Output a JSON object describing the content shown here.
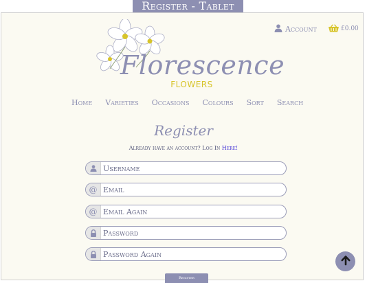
{
  "caption": "Register - Tablet",
  "header": {
    "account_label": "Account",
    "cart_amount": "£0.00",
    "brand_name": "Florescence",
    "brand_sub": "FLOWERS"
  },
  "nav": {
    "items": [
      "Home",
      "Varieties",
      "Occasions",
      "Colours",
      "Sort",
      "Search"
    ]
  },
  "form": {
    "title": "Register",
    "account_prompt": "Already have an account? Log In",
    "login_link": "Here!",
    "username_placeholder": "Username",
    "email_placeholder": "Email",
    "email_again_placeholder": "Email Again",
    "password_placeholder": "Password",
    "password_again_placeholder": "Password Again",
    "submit_label": "Register"
  },
  "colors": {
    "accent": "#8d8fb2",
    "brand_yellow": "#d7c42a",
    "background": "#fbfaf2",
    "link": "#3f2fd6"
  },
  "icons": {
    "account": "user-icon",
    "cart": "basket-icon",
    "username": "user-icon",
    "email": "at-icon",
    "password": "lock-icon",
    "back_to_top": "arrow-up-icon"
  }
}
